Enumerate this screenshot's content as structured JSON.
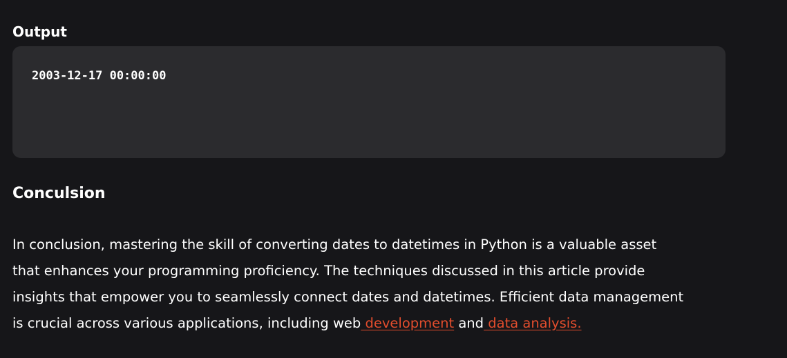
{
  "output_section": {
    "heading": "Output",
    "code": "2003-12-17 00:00:00"
  },
  "conclusion_section": {
    "heading": "Conculsion",
    "lines": [
      "In conclusion, mastering the skill of converting dates to datetimes in Python is a valuable asset",
      "that enhances your programming proficiency. The techniques discussed in this article provide",
      "insights that empower you to seamlessly connect dates and datetimes. Efficient data management"
    ],
    "last_line_prefix": "is crucial across various applications, including web",
    "link_development": " development",
    "connector": " and",
    "link_data_analysis": " data analysis."
  },
  "colors": {
    "background": "#161619",
    "code_background": "#2b2b2e",
    "link": "#e34d2d",
    "text": "#ffffff"
  }
}
